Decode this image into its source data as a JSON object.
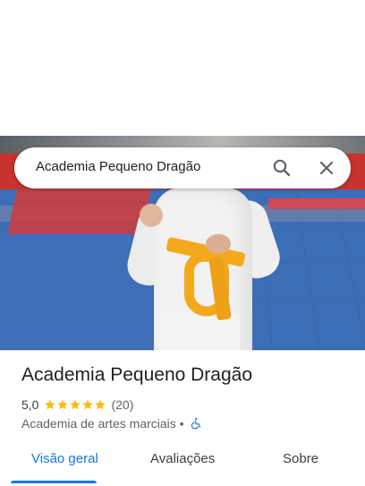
{
  "search": {
    "query": "Academia Pequeno Dragão"
  },
  "place": {
    "title": "Academia Pequeno Dragão",
    "rating": "5,0",
    "stars": 5,
    "review_count": "(20)",
    "category": "Academia de artes marciais",
    "separator": "•"
  },
  "tabs": [
    {
      "label": "Visão geral",
      "active": true
    },
    {
      "label": "Avaliações",
      "active": false
    },
    {
      "label": "Sobre",
      "active": false
    }
  ],
  "icons": {
    "search": "search-icon",
    "close": "close-icon",
    "star": "star-icon",
    "wheelchair": "wheelchair-accessible-icon"
  },
  "colors": {
    "accent": "#1a73e8",
    "star": "#fbbc04",
    "text": "#202124",
    "secondary_text": "#5f6368"
  }
}
